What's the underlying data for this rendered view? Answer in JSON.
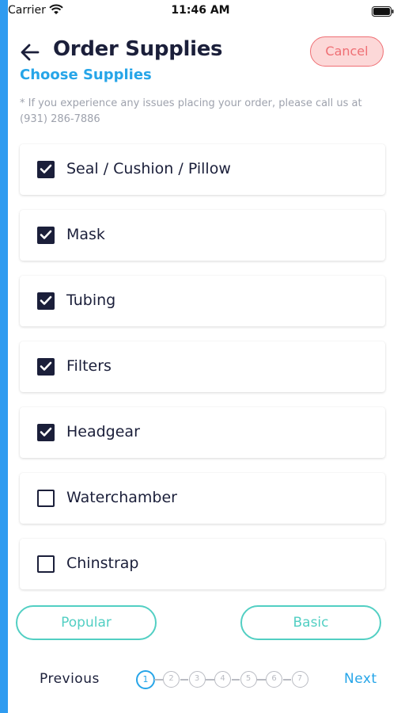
{
  "status_bar": {
    "carrier": "Carrier",
    "time": "11:46 AM"
  },
  "header": {
    "title": "Order Supplies",
    "subtitle": "Choose Supplies",
    "cancel_label": "Cancel",
    "notice": "* If you experience any issues placing your order, please call us at (931) 286-7886"
  },
  "supplies": [
    {
      "label": "Seal / Cushion / Pillow",
      "checked": true
    },
    {
      "label": "Mask",
      "checked": true
    },
    {
      "label": "Tubing",
      "checked": true
    },
    {
      "label": "Filters",
      "checked": true
    },
    {
      "label": "Headgear",
      "checked": true
    },
    {
      "label": "Waterchamber",
      "checked": false
    },
    {
      "label": "Chinstrap",
      "checked": false
    }
  ],
  "presets": {
    "popular_label": "Popular",
    "basic_label": "Basic"
  },
  "pager": {
    "previous_label": "Previous",
    "next_label": "Next",
    "steps": [
      "1",
      "2",
      "3",
      "4",
      "5",
      "6",
      "7"
    ],
    "current_step": 1
  },
  "colors": {
    "accent_blue": "#26a5e8",
    "navy": "#1b1f3a",
    "teal": "#52cfc3",
    "cancel_red": "#ef6f74",
    "cancel_bg": "#fcd8d8"
  },
  "icons": {
    "back": "arrow-left-icon",
    "check": "check-icon",
    "wifi": "wifi-icon",
    "battery": "battery-icon"
  }
}
